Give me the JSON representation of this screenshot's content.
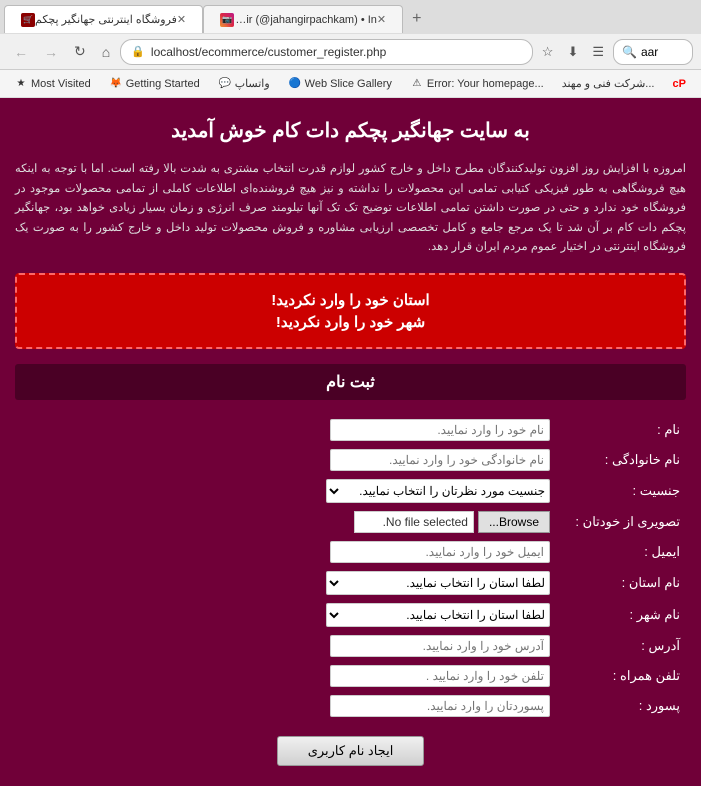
{
  "browser": {
    "tabs": [
      {
        "id": "tab1",
        "title": "فروشگاه اینترنتی جهانگیر پچکم",
        "favicon": "shop",
        "active": true
      },
      {
        "id": "tab2",
        "title": "jahangir (@jahangirpachkam) • In...",
        "favicon": "ig",
        "active": false
      }
    ],
    "new_tab_label": "+",
    "address": "localhost/ecommerce/customer_register.php",
    "nav": {
      "back": "←",
      "forward": "→",
      "refresh": "↻",
      "home": "⌂"
    },
    "search_placeholder": "aar",
    "bookmarks": [
      {
        "id": "most-visited",
        "label": "Most Visited",
        "icon": "★"
      },
      {
        "id": "getting-started",
        "label": "Getting Started",
        "icon": "🦊"
      },
      {
        "id": "whatsapp",
        "label": "واتساپ",
        "icon": "💬"
      },
      {
        "id": "web-slice",
        "label": "Web Slice Gallery",
        "icon": "🔵"
      },
      {
        "id": "error",
        "label": "Error: Your homepage...",
        "icon": "⚠"
      },
      {
        "id": "company",
        "label": "شرکت فنی و مهند...",
        "icon": "🏢"
      },
      {
        "id": "cp",
        "label": "cP",
        "icon": ""
      }
    ]
  },
  "page": {
    "title": "به سایت جهانگیر پچکم دات کام خوش آمدید",
    "intro": "امروزه با افزایش روز افزون تولیدکنندگان مطرح داخل و خارج کشور لوازم قدرت انتخاب مشتری به شدت بالا رفته است. اما با توجه به اینکه هیچ فروشگاهی به طور فیزیکی کتیابی تمامی این محصولات را نداشته و نیز هیچ فروشنده‌ای اطلاعات کاملی از تمامی محصولات موجود در فروشگاه خود ندارد و حتی در صورت داشتن تمامی اطلاعات توضیح تک تک آنها تیلومند صرف انرژی و زمان بسیار زیادی خواهد بود، جهانگیر پچکم دات کام بر آن شد تا یک مرجع جامع و کامل تخصصی ارزیابی مشاوره و فروش محصولات تولید داخل و خارج کشور را به صورت یک فروشگاه اینترنتی در اختیار عموم مردم ایران قرار دهد.",
    "error_messages": [
      "استان خود را وارد نکردید!",
      "شهر خود را وارد نکردید!"
    ],
    "form_section_title": "ثبت نام",
    "form": {
      "fields": [
        {
          "id": "name",
          "label": "نام :",
          "type": "text",
          "placeholder": "نام خود را وارد نمایید."
        },
        {
          "id": "family",
          "label": "نام خانوادگی :",
          "type": "text",
          "placeholder": "نام خانوادگی خود را وارد نمایید."
        },
        {
          "id": "gender",
          "label": "جنسیت :",
          "type": "select",
          "placeholder": "جنسیت مورد نظرتان را انتخاب نمایید."
        },
        {
          "id": "photo",
          "label": "تصویری از خودتان :",
          "type": "file",
          "browse_label": "Browse...",
          "no_file_label": "No file selected."
        },
        {
          "id": "email",
          "label": "ایمیل :",
          "type": "text",
          "placeholder": "ایمیل خود را وارد نمایید."
        },
        {
          "id": "province",
          "label": "نام استان :",
          "type": "select",
          "placeholder": "لطفا استان را انتخاب نمایید."
        },
        {
          "id": "city",
          "label": "نام شهر :",
          "type": "select",
          "placeholder": "لطفا استان را انتخاب نمایید."
        },
        {
          "id": "address",
          "label": "آدرس :",
          "type": "text",
          "placeholder": "آدرس خود را وارد نمایید."
        },
        {
          "id": "phone",
          "label": "تلفن همراه :",
          "type": "text",
          "placeholder": "تلفن خود را وارد نمایید ."
        },
        {
          "id": "password",
          "label": "پسورد :",
          "type": "password",
          "placeholder": "پسوردتان را وارد نمایید."
        }
      ],
      "submit_label": "ایجاد نام کاربری"
    }
  },
  "colors": {
    "page_bg": "#700038",
    "error_bg": "#cc0000",
    "error_border": "#ff6666",
    "form_section_bg": "#4a0025",
    "text_light": "#fff",
    "text_intro": "#ddd"
  }
}
